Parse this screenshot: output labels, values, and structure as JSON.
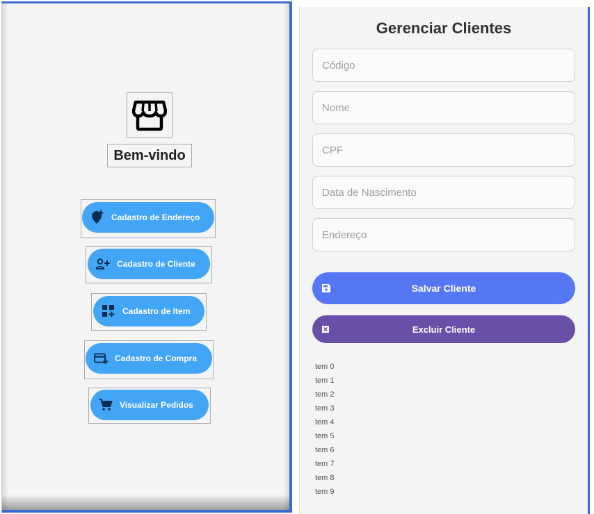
{
  "home": {
    "welcome": "Bem-vindo",
    "store_icon": "storefront-icon",
    "menu": [
      {
        "label": "Cadastro de Endereço",
        "icon": "add-location-icon"
      },
      {
        "label": "Cadastro de Cliente",
        "icon": "person-add-icon"
      },
      {
        "label": "Cadastro de Item",
        "icon": "add-grid-icon"
      },
      {
        "label": "Cadastro de Compra",
        "icon": "add-card-icon"
      },
      {
        "label": "Visualizar Pedidos",
        "icon": "cart-icon"
      }
    ]
  },
  "clients": {
    "title": "Gerenciar Clientes",
    "fields": [
      {
        "placeholder": "Código",
        "value": ""
      },
      {
        "placeholder": "Nome",
        "value": ""
      },
      {
        "placeholder": "CPF",
        "value": ""
      },
      {
        "placeholder": "Data de Nascimento",
        "value": ""
      },
      {
        "placeholder": "Endereço",
        "value": ""
      }
    ],
    "save_label": "Salvar Cliente",
    "delete_label": "Excluir Cliente",
    "items": [
      "tem 0",
      "tem 1",
      "tem 2",
      "tem 3",
      "tem 4",
      "tem 5",
      "tem 6",
      "tem 7",
      "tem 8",
      "tem 9"
    ]
  },
  "colors": {
    "primary_blue": "#42a5f5",
    "save_blue": "#5677f4",
    "delete_purple": "#6a4fa8",
    "frame_blue": "#3a6bd0"
  }
}
